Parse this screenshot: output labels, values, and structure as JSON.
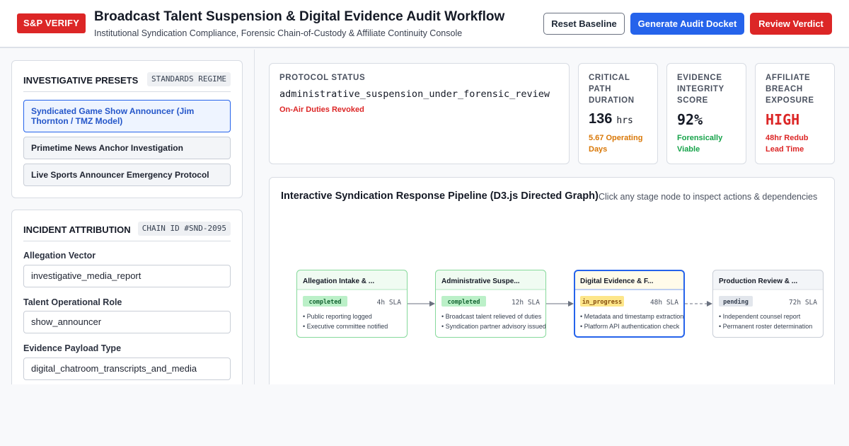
{
  "header": {
    "brand": "S&P VERIFY",
    "title": "Broadcast Talent Suspension & Digital Evidence Audit Workflow",
    "subtitle": "Institutional Syndication Compliance, Forensic Chain-of-Custody & Affiliate Continuity Console",
    "buttons": {
      "reset": "Reset Baseline",
      "docket": "Generate Audit Docket",
      "verdict": "Review Verdict"
    }
  },
  "presets": {
    "heading": "INVESTIGATIVE PRESETS",
    "tag": "STANDARDS REGIME",
    "items": [
      "Syndicated Game Show Announcer (Jim Thornton / TMZ Model)",
      "Primetime News Anchor Investigation",
      "Live Sports Announcer Emergency Protocol"
    ]
  },
  "attribution": {
    "heading": "INCIDENT ATTRIBUTION",
    "tag": "CHAIN ID #SND-2095",
    "fields": [
      {
        "label": "Allegation Vector",
        "value": "investigative_media_report"
      },
      {
        "label": "Talent Operational Role",
        "value": "show_announcer"
      },
      {
        "label": "Evidence Payload Type",
        "value": "digital_chatroom_transcripts_and_media"
      }
    ]
  },
  "stats": {
    "protocol": {
      "label": "PROTOCOL STATUS",
      "value": "administrative_suspension_under_forensic_review",
      "note": "On-Air Duties Revoked",
      "note_color": "#dc2626"
    },
    "critical": {
      "label": [
        "CRITICAL",
        "PATH",
        "DURATION"
      ],
      "value": "136",
      "unit": "hrs",
      "note": [
        "5.67 Operating",
        "Days"
      ],
      "note_color": "#d97706"
    },
    "integrity": {
      "label": [
        "EVIDENCE",
        "INTEGRITY",
        "SCORE"
      ],
      "value": "92%",
      "note": [
        "Forensically",
        "Viable"
      ],
      "note_color": "#16a34a"
    },
    "affiliate": {
      "label": [
        "AFFILIATE",
        "BREACH",
        "EXPOSURE"
      ],
      "value": "HIGH",
      "value_color": "#dc2626",
      "note": [
        "48hr Redub",
        "Lead Time"
      ],
      "note_color": "#dc2626"
    }
  },
  "pipeline": {
    "title": "Interactive Syndication Response Pipeline (D3.js Directed Graph)",
    "hint": "Click any stage node to inspect actions & dependencies",
    "nodes": [
      {
        "title": "Allegation Intake & ...",
        "status": "completed",
        "sla": "4h SLA",
        "bullets": [
          "• Public reporting logged",
          "• Executive committee notified"
        ]
      },
      {
        "title": "Administrative Suspe...",
        "status": "completed",
        "sla": "12h SLA",
        "bullets": [
          "• Broadcast talent relieved of duties",
          "• Syndication partner advisory issued"
        ]
      },
      {
        "title": "Digital Evidence & F...",
        "status": "in_progress",
        "sla": "48h SLA",
        "bullets": [
          "• Metadata and timestamp extraction",
          "• Platform API authentication check"
        ]
      },
      {
        "title": "Production Review & ...",
        "status": "pending",
        "sla": "72h SLA",
        "bullets": [
          "• Independent counsel report",
          "• Permanent roster determination"
        ]
      }
    ],
    "colors": {
      "completed_header": "#f0fbf2",
      "completed_border": "#86d99b",
      "completed_badge_bg": "#bbf0c8",
      "completed_badge_fg": "#166534",
      "progress_header": "#fffbea",
      "progress_border": "#2563eb",
      "progress_badge_bg": "#fde68a",
      "progress_badge_fg": "#854d0e",
      "pending_header": "#f3f5f8",
      "pending_border": "#c9ced7",
      "pending_badge_bg": "#e2e6ec",
      "pending_badge_fg": "#374151"
    }
  }
}
